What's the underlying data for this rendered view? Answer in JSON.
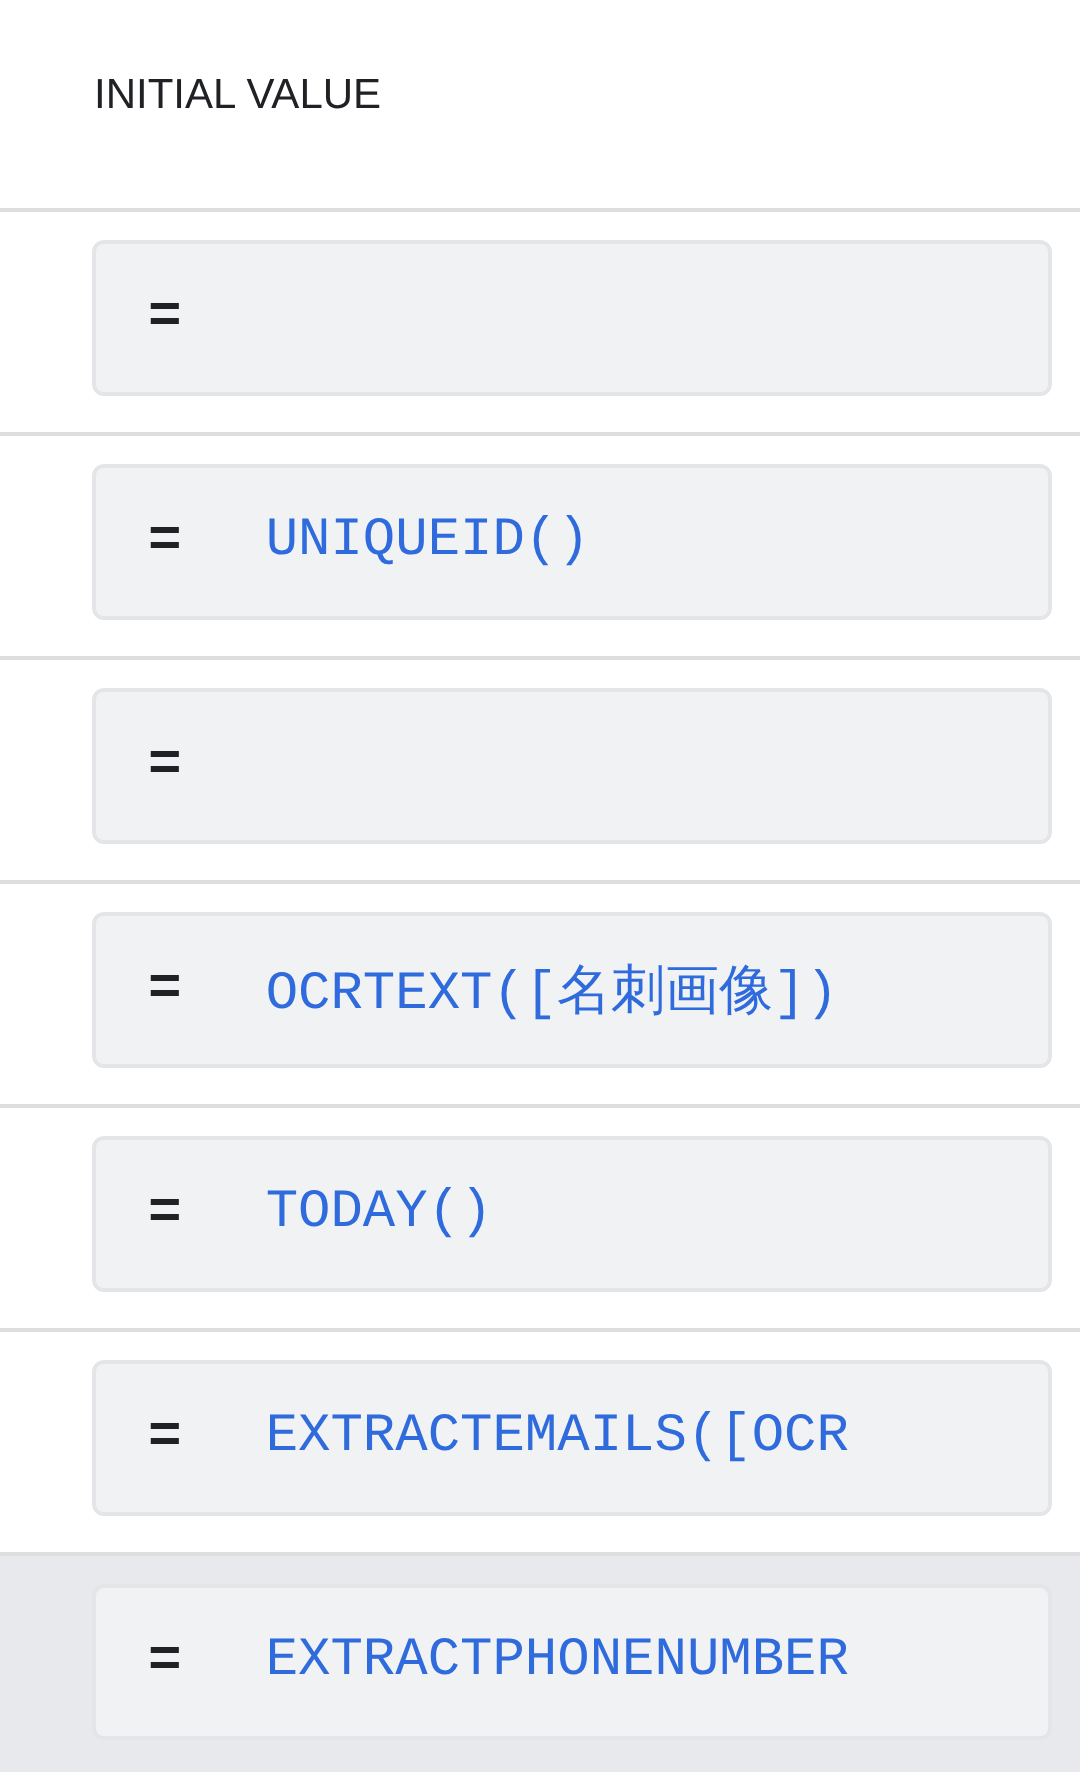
{
  "column_header": "INITIAL VALUE",
  "rows": [
    {
      "operator": "=",
      "selected": false
    },
    {
      "operator": "=",
      "formula": "UNIQUEID()",
      "selected": false
    },
    {
      "operator": "=",
      "selected": false
    },
    {
      "operator": "=",
      "formula": "OCRTEXT([名刺画像])",
      "selected": false
    },
    {
      "operator": "=",
      "formula": "TODAY()",
      "selected": false
    },
    {
      "operator": "=",
      "formula": "EXTRACTEMAILS([OCR",
      "selected": false
    },
    {
      "operator": "=",
      "formula": "EXTRACTPHONENUMBER",
      "selected": true
    }
  ]
}
